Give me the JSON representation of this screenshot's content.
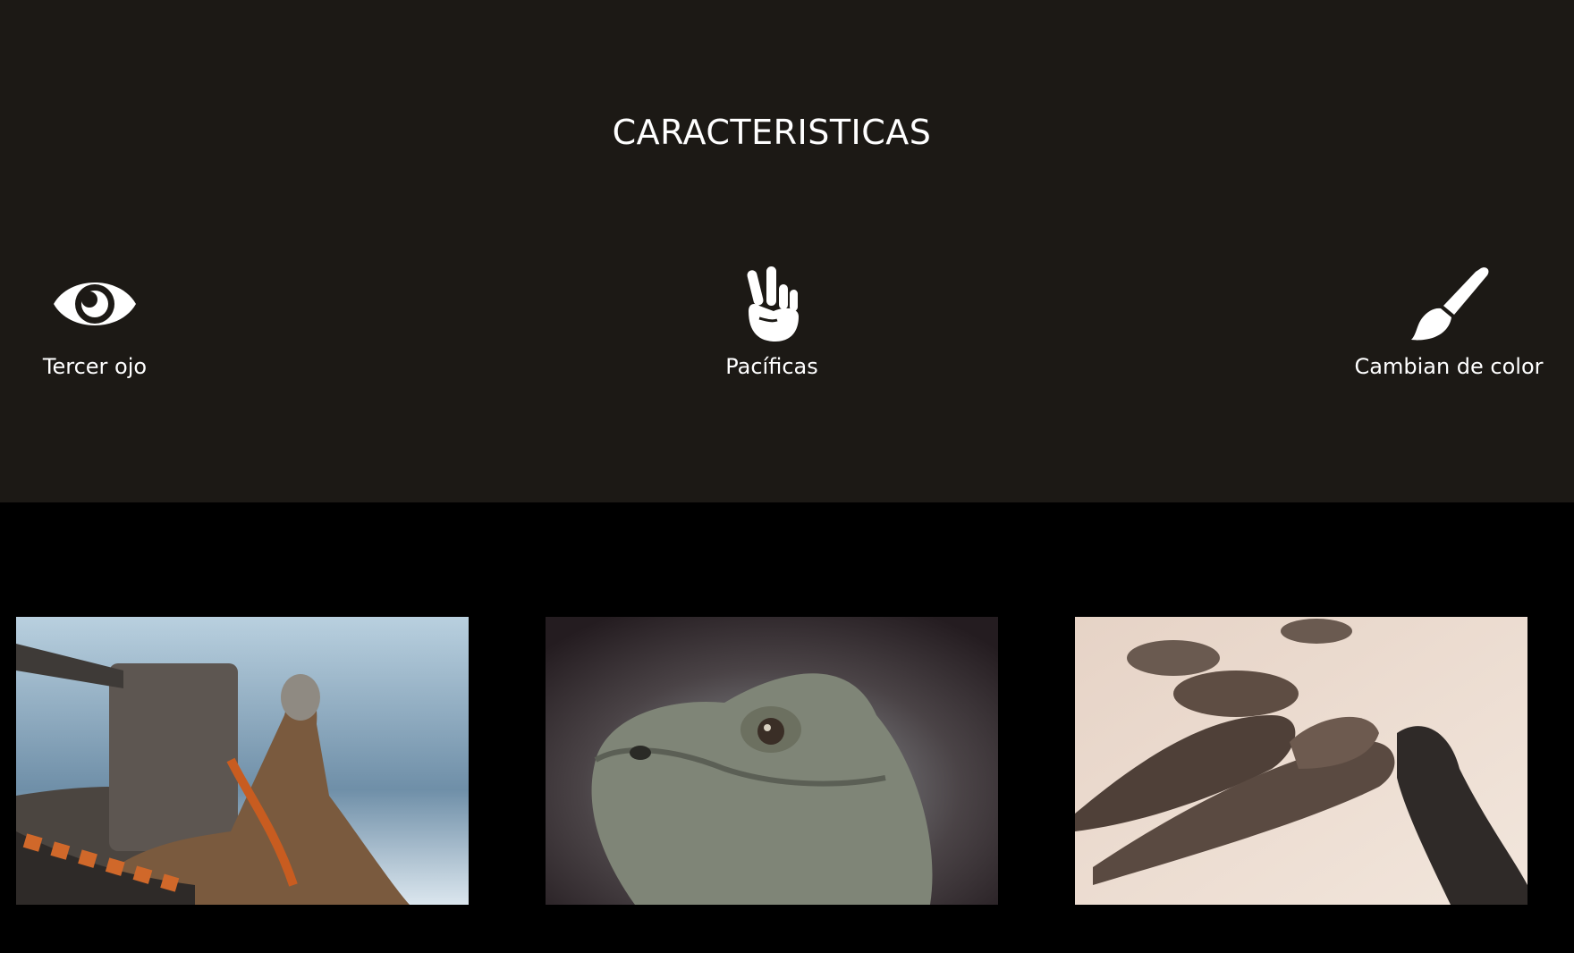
{
  "features_section": {
    "title": "CARACTERISTICAS",
    "background": "#1c1915",
    "items": [
      {
        "icon": "eye-icon",
        "label": "Tercer ojo"
      },
      {
        "icon": "peace-hand-icon",
        "label": "Pacíficas"
      },
      {
        "icon": "paint-brush-icon",
        "label": "Cambian de color"
      }
    ]
  },
  "gallery": {
    "background": "#000000",
    "photos": [
      {
        "subject": "iguana-by-water-photo"
      },
      {
        "subject": "iguana-head-closeup-photo"
      },
      {
        "subject": "iguanas-on-sand-photo"
      }
    ]
  }
}
